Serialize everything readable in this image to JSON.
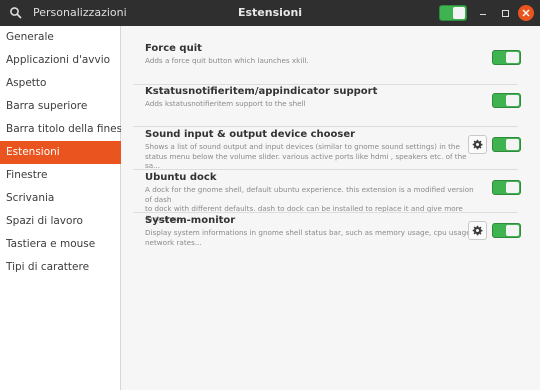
{
  "header": {
    "app_title": "Personalizzazioni",
    "page_title": "Estensioni",
    "extensions_enabled": true
  },
  "sidebar": {
    "items": [
      {
        "label": "Generale"
      },
      {
        "label": "Applicazioni d'avvio"
      },
      {
        "label": "Aspetto"
      },
      {
        "label": "Barra superiore"
      },
      {
        "label": "Barra titolo della finestra"
      },
      {
        "label": "Estensioni",
        "active": true
      },
      {
        "label": "Finestre"
      },
      {
        "label": "Scrivania"
      },
      {
        "label": "Spazi di lavoro"
      },
      {
        "label": "Tastiera e mouse"
      },
      {
        "label": "Tipi di carattere"
      }
    ]
  },
  "extensions": [
    {
      "name": "Force quit",
      "description": "Adds a force quit button which launches xkill.",
      "enabled": true,
      "has_settings": false
    },
    {
      "name": "Kstatusnotifieritem/appindicator support",
      "description": "Adds kstatusnotifieritem support to the shell",
      "enabled": true,
      "has_settings": false
    },
    {
      "name": "Sound input & output device chooser",
      "description": "Shows a list of sound output and input devices (similar to gnome sound settings) in the\nstatus menu below the volume slider. various active ports like hdmi , speakers etc. of the sa...",
      "enabled": true,
      "has_settings": true
    },
    {
      "name": "Ubuntu dock",
      "description": "A dock for the gnome shell, default ubuntu experience. this extension is a modified version of dash\nto dock with different defaults. dash to dock can be installed to replace it and give more (but unsu...",
      "enabled": true,
      "has_settings": false
    },
    {
      "name": "System-monitor",
      "description": "Display system informations in gnome shell status bar, such as memory usage, cpu usage,\nnetwork rates...",
      "enabled": true,
      "has_settings": true
    }
  ],
  "colors": {
    "accent": "#e9541f",
    "toggle_on": "#3eb34f",
    "headerbar": "#2f2f2f"
  },
  "icons": {
    "search": "search-icon",
    "minimize": "minimize-icon",
    "maximize": "maximize-icon",
    "close": "close-icon",
    "settings": "gear-icon"
  }
}
